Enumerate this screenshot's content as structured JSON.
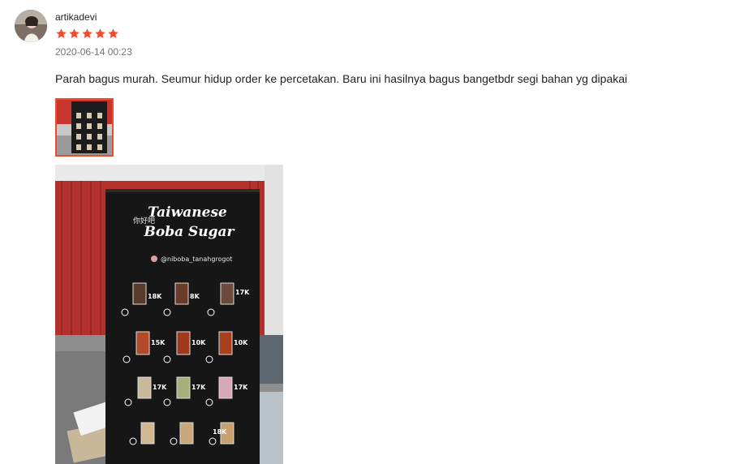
{
  "review": {
    "username": "artikadevi",
    "rating": 5,
    "timestamp": "2020-06-14 00:23",
    "text": "Parah bagus murah. Seumur hidup order ke percetakan. Baru ini hasilnya bagus bangetbdr segi bahan yg dipakai"
  },
  "colors": {
    "star": "#ee4d2d",
    "thumb_border": "#ee4d2d"
  },
  "banner": {
    "title_line1": "Taiwanese",
    "title_line2": "Boba Sugar",
    "handle": "@niboba_tanahgrogot",
    "prices": [
      "18K",
      "8K",
      "17K",
      "15K",
      "10K",
      "10K",
      "17K",
      "17K",
      "17K",
      "18K"
    ]
  }
}
